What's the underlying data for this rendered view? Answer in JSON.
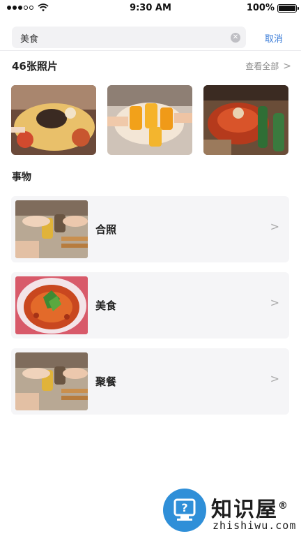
{
  "status_bar": {
    "time": "9:30 AM",
    "battery": "100%"
  },
  "search": {
    "query": "美食",
    "cancel_label": "取消"
  },
  "photos": {
    "title": "46张照片",
    "see_all_label": "查看全部"
  },
  "things": {
    "title": "事物",
    "items": [
      {
        "label": "合照"
      },
      {
        "label": "美食"
      },
      {
        "label": "聚餐"
      }
    ]
  },
  "watermark": {
    "title": "知识屋",
    "registered": "®",
    "url": "zhishiwu.com"
  },
  "icons": [
    "signal-dots",
    "wifi-icon",
    "battery-icon",
    "clear-icon",
    "chevron-right-icon"
  ],
  "colors": {
    "accent": "#3f7fd9",
    "card_bg": "#f5f5f7",
    "watermark_blue": "#2f8fd8"
  }
}
